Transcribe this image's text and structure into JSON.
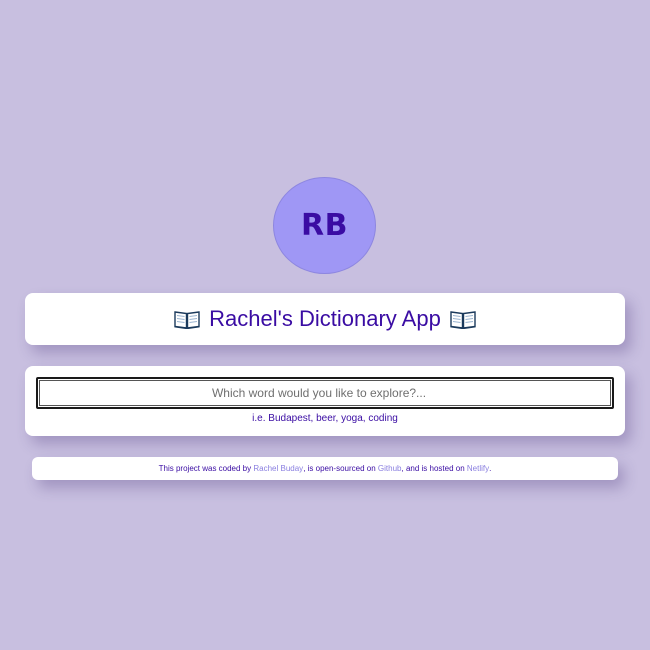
{
  "logo": {
    "initials": "RB"
  },
  "header": {
    "title": "Rachel's Dictionary App",
    "icon": "open-book-icon"
  },
  "search": {
    "placeholder": "Which word would you like to explore?...",
    "value": "",
    "hint": "i.e. Budapest, beer, yoga, coding"
  },
  "footer": {
    "text_1": "This project was coded by",
    "author_link": "Rachel Buday",
    "text_2": ", is open-sourced on",
    "github_link": "Github",
    "text_3": ", and is hosted on",
    "netlify_link": "Netlify",
    "text_4": "."
  },
  "colors": {
    "background": "#c8bfe0",
    "accent": "#3a0ca3",
    "logo_bg": "#9f97f5",
    "link": "#8a7fe0"
  }
}
